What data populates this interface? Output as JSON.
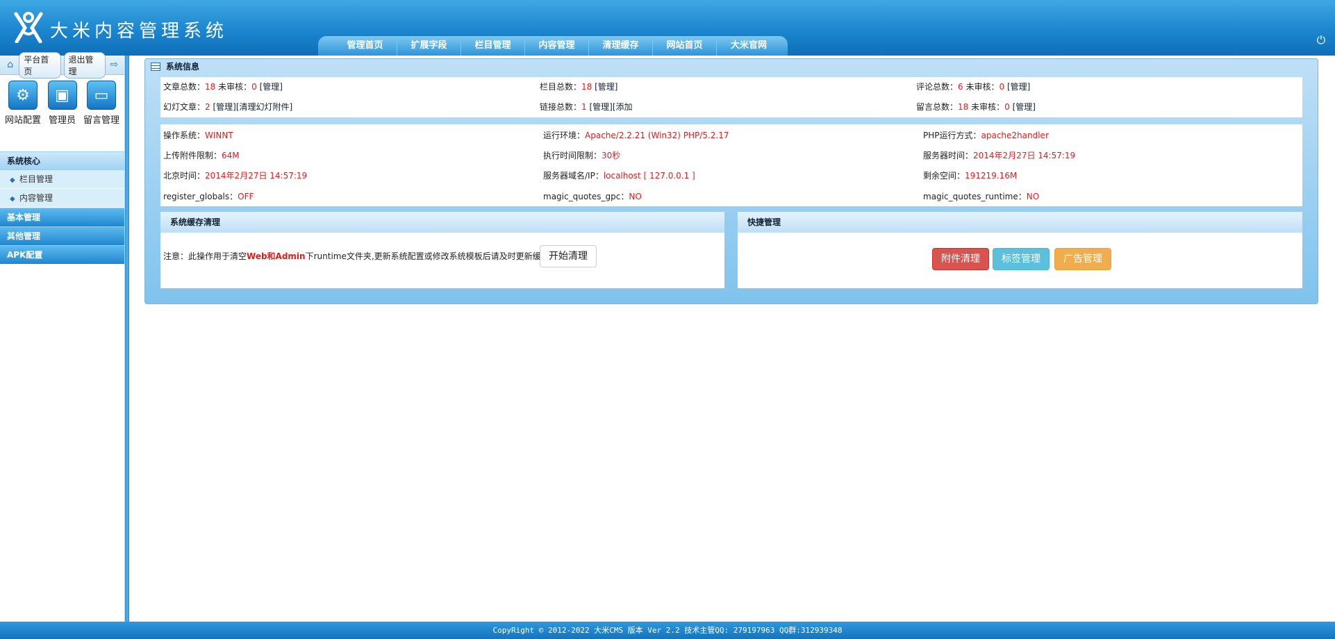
{
  "app": {
    "brand": "大米内容管理系统"
  },
  "topnav": [
    "管理首页",
    "扩展字段",
    "栏目管理",
    "内容管理",
    "清理缓存",
    "网站首页",
    "大米官网"
  ],
  "sidebar": {
    "top_buttons": [
      "平台首页",
      "退出管理"
    ],
    "quick": [
      {
        "label": "网站配置",
        "icon": "gear-icon"
      },
      {
        "label": "管理员",
        "icon": "id-card-icon"
      },
      {
        "label": "留言管理",
        "icon": "monitor-chat-icon"
      }
    ],
    "sections": [
      {
        "title": "系统核心",
        "items": [
          "栏目管理",
          "内容管理"
        ]
      },
      {
        "title": "基本管理"
      },
      {
        "title": "其他管理"
      },
      {
        "title": "APK配置"
      }
    ]
  },
  "panel": {
    "title": "系统信息"
  },
  "stats": {
    "articles": {
      "label": "文章总数：",
      "value": "18",
      "pending_label": " 未审核：",
      "pending": "0",
      "link": "[管理]"
    },
    "categories": {
      "label": "栏目总数：",
      "value": "18",
      "link": "[管理]"
    },
    "comments": {
      "label": "评论总数：",
      "value": "6",
      "pending_label": " 未审核：",
      "pending": "0",
      "link": "[管理]"
    },
    "slides": {
      "label": "幻灯文章：",
      "value": "2",
      "link1": "[管理]",
      "link2": "[清理幻灯附件]"
    },
    "links": {
      "label": "链接总数：",
      "value": "1",
      "link1": "[管理]",
      "link2": "[添加"
    },
    "messages": {
      "label": "留言总数：",
      "value": "18",
      "pending_label": " 未审核：",
      "pending": "0",
      "link": "[管理]"
    }
  },
  "sysinfo": {
    "os": {
      "label": "操作系统：",
      "value": "WINNT"
    },
    "env": {
      "label": "运行环境：",
      "value": "Apache/2.2.21 (Win32) PHP/5.2.17"
    },
    "php_mode": {
      "label": "PHP运行方式：",
      "value": "apache2handler"
    },
    "upload": {
      "label": "上传附件限制：",
      "value": "64M"
    },
    "exec": {
      "label": "执行时间限制：",
      "value": "30秒"
    },
    "server_time": {
      "label": "服务器时间：",
      "value": "2014年2月27日 14:57:19"
    },
    "bj_time": {
      "label": "北京时间：",
      "value": "2014年2月27日 14:57:19"
    },
    "server_name": {
      "label": "服务器域名/IP：",
      "value": "localhost [ 127.0.0.1 ]"
    },
    "space": {
      "label": "剩余空间：",
      "value": "191219.16M"
    },
    "globals": {
      "label": "register_globals：",
      "value": "OFF"
    },
    "gpc": {
      "label": "magic_quotes_gpc：",
      "value": "NO"
    },
    "runtime": {
      "label": "magic_quotes_runtime：",
      "value": "NO"
    }
  },
  "cache": {
    "title": "系统缓存清理",
    "notice_prefix": "注意：此操作用于清空",
    "notice_em": "Web和Admin",
    "notice_suffix": "下runtime文件夹,更新系统配置或修改系统模板后请及时更新缓存",
    "button": "开始清理"
  },
  "quickmgmt": {
    "title": "快捷管理",
    "buttons": [
      "附件清理",
      "标签管理",
      "广告管理"
    ]
  },
  "footer": "CopyRight © 2012-2022 大米CMS 版本 Ver 2.2 技术主管QQ: 279197963 QQ群:312939348"
}
